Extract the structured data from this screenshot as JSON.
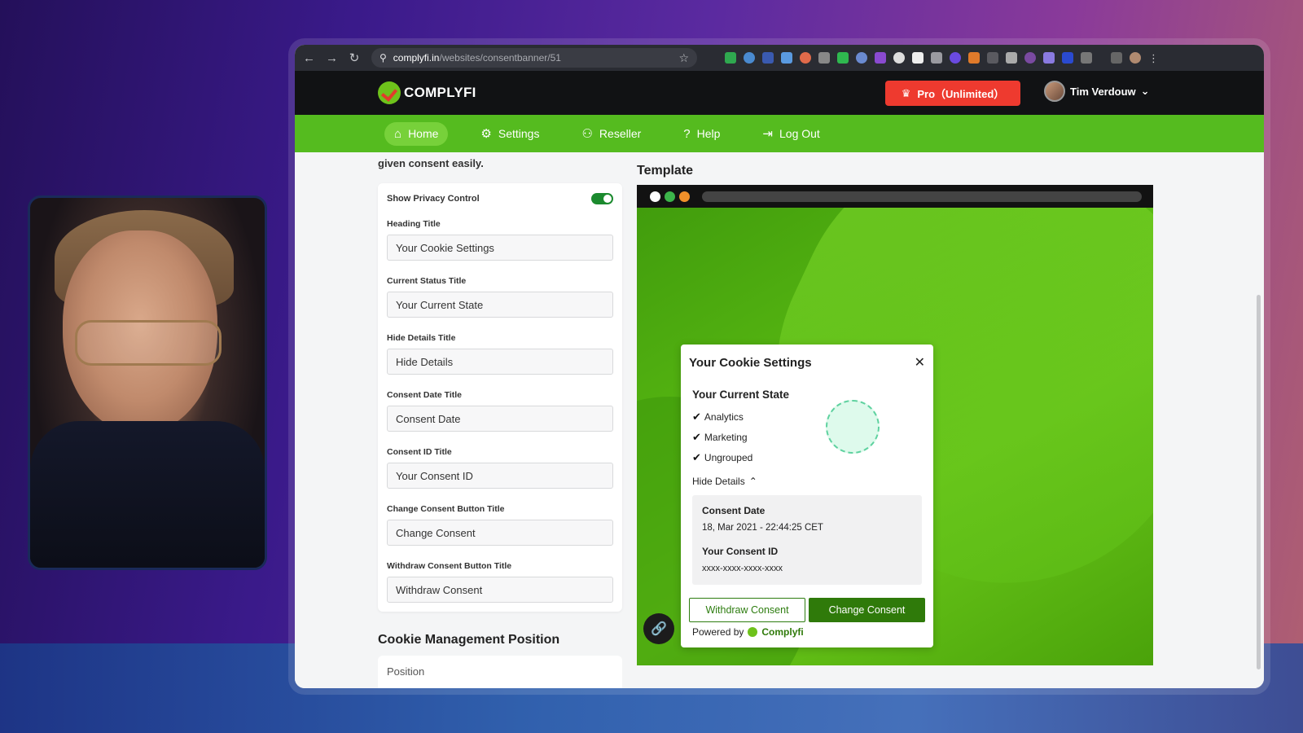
{
  "browser": {
    "url_host": "complyfi.in",
    "url_path": "/websites/consentbanner/51",
    "back_icon": "←",
    "forward_icon": "→",
    "reload_icon": "↻"
  },
  "header": {
    "logo_text": "COMPLYFI",
    "pro_label": "Pro（Unlimited）",
    "user_name": "Tim Verdouw"
  },
  "nav": {
    "items": [
      {
        "label": "Home",
        "icon": "⌂"
      },
      {
        "label": "Settings",
        "icon": "⚙"
      },
      {
        "label": "Reseller",
        "icon": "⚇"
      },
      {
        "label": "Help",
        "icon": "?"
      },
      {
        "label": "Log Out",
        "icon": "⇥"
      }
    ]
  },
  "form": {
    "intro": "given consent easily.",
    "toggle_label": "Show Privacy Control",
    "fields": [
      {
        "label": "Heading Title",
        "value": "Your Cookie Settings"
      },
      {
        "label": "Current Status Title",
        "value": "Your Current State"
      },
      {
        "label": "Hide Details Title",
        "value": "Hide Details"
      },
      {
        "label": "Consent Date Title",
        "value": "Consent Date"
      },
      {
        "label": "Consent ID Title",
        "value": "Your Consent ID"
      },
      {
        "label": "Change Consent Button Title",
        "value": "Change Consent"
      },
      {
        "label": "Withdraw Consent Button Title",
        "value": "Withdraw Consent"
      }
    ],
    "section_title": "Cookie Management Position",
    "position_label": "Position"
  },
  "template": {
    "title": "Template",
    "modal": {
      "heading": "Your Cookie Settings",
      "state_title": "Your Current State",
      "items": [
        "Analytics",
        "Marketing",
        "Ungrouped"
      ],
      "hide_details": "Hide Details",
      "consent_date_label": "Consent Date",
      "consent_date_value": "18, Mar 2021 - 22:44:25 CET",
      "consent_id_label": "Your Consent ID",
      "consent_id_value": "xxxx-xxxx-xxxx-xxxx",
      "withdraw_label": "Withdraw Consent",
      "change_label": "Change Consent",
      "powered_by": "Powered by",
      "brand": "Complyfi"
    }
  },
  "colors": {
    "accent_green": "#55bb1f",
    "pro_red": "#ee3a2f",
    "dark_green": "#2f7a0a"
  }
}
